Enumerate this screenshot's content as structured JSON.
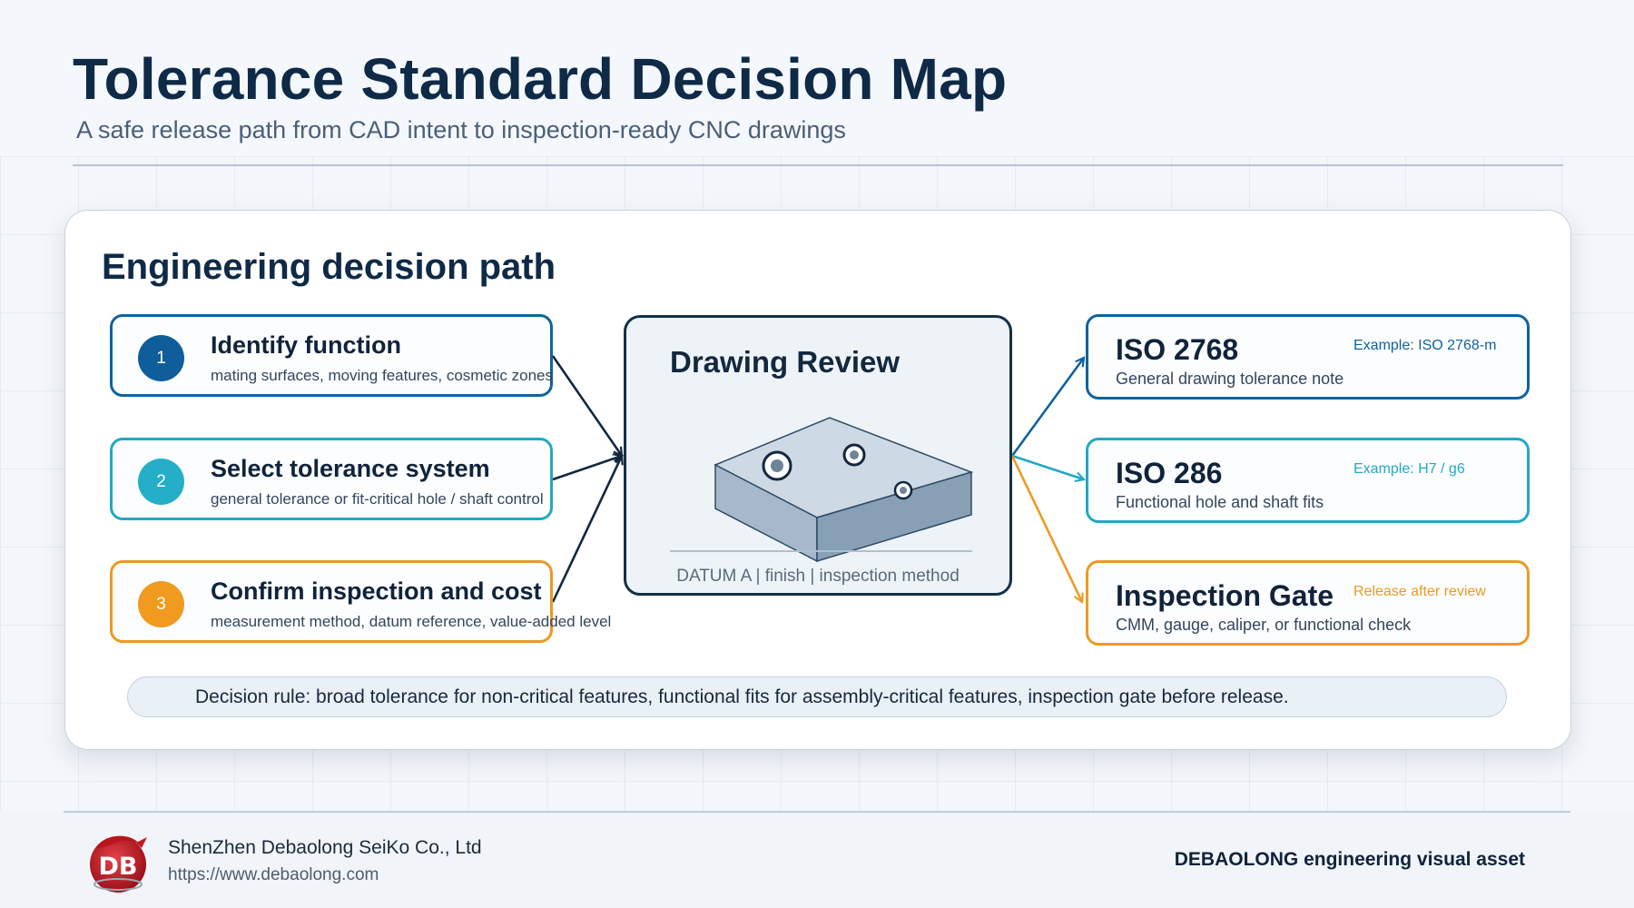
{
  "header": {
    "title": "Tolerance Standard Decision Map",
    "subtitle": "A safe release path from CAD intent to inspection-ready CNC drawings"
  },
  "section": {
    "title": "Engineering decision path"
  },
  "steps": [
    {
      "number": "1",
      "title": "Identify function",
      "description": "mating surfaces, moving features, cosmetic zones",
      "color": "#0f5e9a"
    },
    {
      "number": "2",
      "title": "Select tolerance system",
      "description": "general tolerance or fit-critical hole / shaft control",
      "color": "#24aec8"
    },
    {
      "number": "3",
      "title": "Confirm inspection and cost",
      "description": "measurement method, datum reference, value-added level",
      "color": "#f09a20"
    }
  ],
  "review": {
    "title": "Drawing Review",
    "caption": "DATUM A  |  finish  |  inspection method"
  },
  "standards": [
    {
      "title": "ISO 2768",
      "example": "Example: ISO 2768-m",
      "description": "General drawing tolerance note",
      "color": "#10629e"
    },
    {
      "title": "ISO 286",
      "example": "Example: H7 / g6",
      "description": "Functional hole and shaft fits",
      "color": "#23a8c4"
    },
    {
      "title": "Inspection Gate",
      "example": "Release after review",
      "description": "CMM, gauge, caliper, or functional check",
      "color": "#ec9a22"
    }
  ],
  "rule": {
    "text": "Decision rule: broad tolerance for non-critical features, functional fits for assembly-critical features, inspection gate before release."
  },
  "footer": {
    "logo_text": "DB",
    "company": "ShenZhen Debaolong SeiKo Co., Ltd",
    "url": "https://www.debaolong.com",
    "brand_tag": "DEBAOLONG engineering visual asset"
  }
}
